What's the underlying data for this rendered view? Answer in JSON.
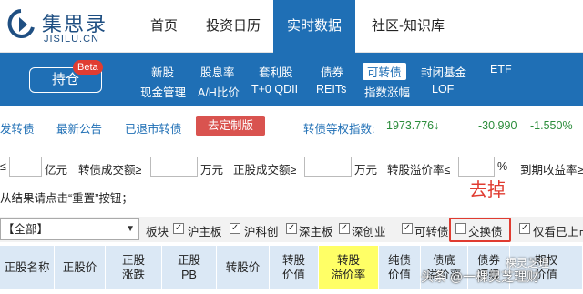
{
  "site": {
    "name_cn": "集思录",
    "name_en": "JISILU.CN"
  },
  "nav": {
    "tabs": [
      "首页",
      "投资日历",
      "实时数据",
      "社区-知识库"
    ]
  },
  "subnav": {
    "hold_label": "持仓",
    "beta": "Beta",
    "row1": [
      "新股",
      "股息率",
      "套利股",
      "债券",
      "可转债",
      "封闭基金",
      "ETF"
    ],
    "row2": [
      "现金管理",
      "A/H比价",
      "T+0 QDII",
      "REITs",
      "指数涨幅",
      "LOF"
    ]
  },
  "links": {
    "items": [
      "发转债",
      "最新公告",
      "已退市转债"
    ],
    "custom_button": "去定制版",
    "index_label": "转债等权指数:",
    "index_value": "1973.776↓",
    "index_change": "-30.990",
    "index_pct": "-1.550%"
  },
  "filters": {
    "t1": "≤",
    "t2": "亿元",
    "t3": "转债成交额≥",
    "t4": "万元",
    "t5": "正股成交额≥",
    "t6": "万元",
    "t7": "转股溢价率≤",
    "t8": "%",
    "t9": "到期收益率≥"
  },
  "tip": "从结果请点击“重置”按钮；",
  "annotation": "去掉",
  "checkrow": {
    "select_value": "【全部】",
    "board_label": "板块",
    "boards": [
      "沪主板",
      "沪科创",
      "深主板",
      "深创业"
    ],
    "kzz": "可转债",
    "jhz": "交换债",
    "only": "仅看已上市"
  },
  "table": {
    "headers": [
      "正股名称",
      "正股价",
      "正股\n涨跌",
      "正股\nPB",
      "转股价",
      "转股\n价值",
      "转股\n溢价率",
      "纯债\n价值",
      "债底\n溢价率",
      "债券\n评级",
      "期权\n价值"
    ]
  },
  "watermark": {
    "main": "头条 @一棵灵芝理财",
    "corner": "棵灵芝理"
  },
  "colors": {
    "brand_blue": "#1f6fb5",
    "down_green": "#2a8c3a",
    "alert_red": "#e03c31",
    "highlight_yellow": "#ffff66"
  }
}
